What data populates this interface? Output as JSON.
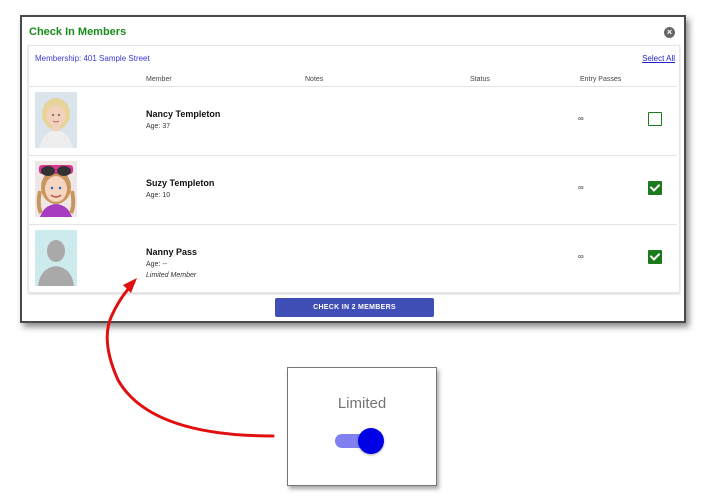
{
  "dialog": {
    "title": "Check In Members",
    "close_icon": "close-circle-icon",
    "membership": "Membership: 401 Sample Street",
    "select_all": "Select All",
    "columns": [
      "Member",
      "Notes",
      "Status",
      "Entry Passes"
    ],
    "members": [
      {
        "name": "Nancy Templeton",
        "age": "Age: 37",
        "note": "",
        "entry_passes": "∞",
        "checked": false,
        "photo": "adult-woman-photo"
      },
      {
        "name": "Suzy Templeton",
        "age": "Age: 10",
        "note": "",
        "entry_passes": "∞",
        "checked": true,
        "photo": "girl-photo"
      },
      {
        "name": "Nanny Pass",
        "age": "Age: --",
        "note": "Limited Member",
        "entry_passes": "∞",
        "checked": true,
        "photo": "placeholder-silhouette"
      }
    ],
    "checkin_button": "CHECK IN 2 MEMBERS"
  },
  "zoom": {
    "label": "Limited",
    "toggle_on": true
  },
  "colors": {
    "title_green": "#1a8c1a",
    "link_blue": "#3a3ad8",
    "checkbox_green": "#1b7a1b",
    "button_blue": "#3f4fb5",
    "arrow_red": "#e01010",
    "toggle_knob": "#0000e6",
    "toggle_track": "#8080f0"
  }
}
